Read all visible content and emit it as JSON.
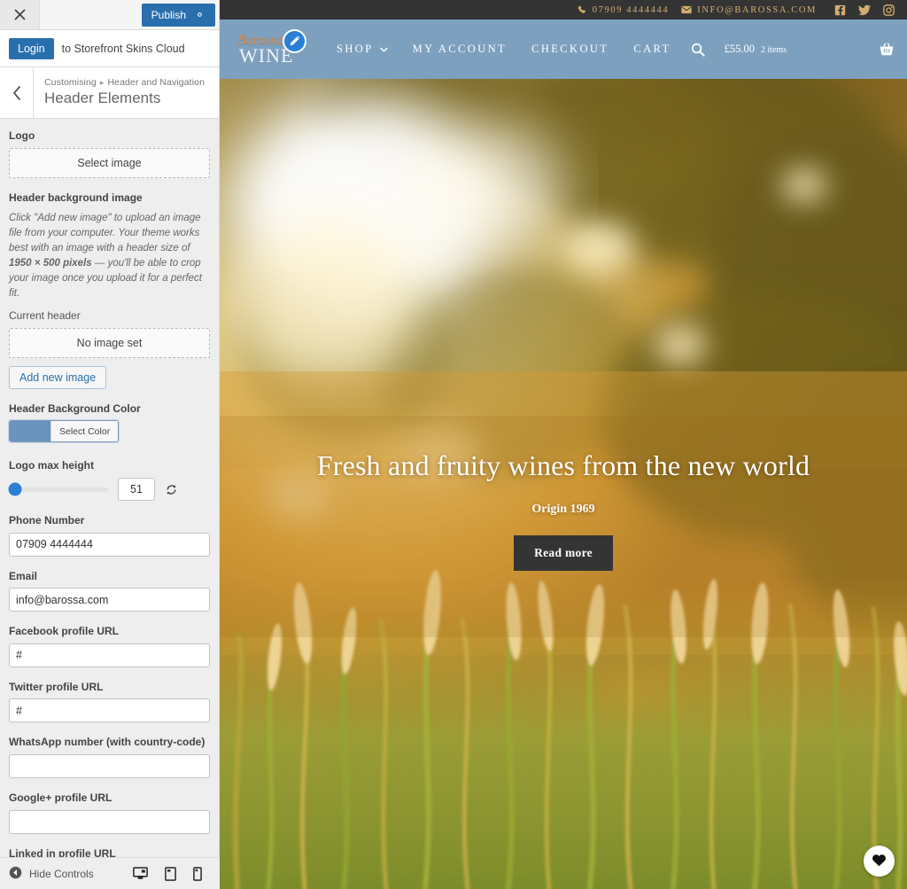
{
  "customizer": {
    "close_label": "Close customizer",
    "publish_label": "Publish",
    "publish_color": "#2a6fad",
    "gear_icon": "gear-icon",
    "cloud_notice": {
      "login_label": "Login",
      "text": "to Storefront Skins Cloud"
    },
    "breadcrumb": {
      "root": "Customising",
      "separator": "▸",
      "parent": "Header and Navigation"
    },
    "panel_title": "Header Elements",
    "controls": {
      "logo": {
        "label": "Logo",
        "button": "Select image"
      },
      "header_background_image": {
        "label": "Header background image",
        "help_before": "Click \"Add new image\" to upload an image file from your computer. Your theme works best with an image with a header size of ",
        "help_dimensions": "1950 × 500 pixels",
        "help_after": " — you'll be able to crop your image once you upload it for a perfect fit.",
        "current_label": "Current header",
        "current_value": "No image set",
        "add_button": "Add new image"
      },
      "header_background_color": {
        "label": "Header Background Color",
        "button": "Select Color",
        "swatch_hex": "#6b93bd"
      },
      "logo_max_height": {
        "label": "Logo max height",
        "value": "51",
        "slider_percent": 6,
        "reset_icon": "reset-icon"
      },
      "phone_number": {
        "label": "Phone Number",
        "value": "07909 4444444",
        "placeholder": ""
      },
      "email": {
        "label": "Email",
        "value": "info@barossa.com",
        "placeholder": ""
      },
      "facebook_url": {
        "label": "Facebook profile URL",
        "value": "#",
        "placeholder": ""
      },
      "twitter_url": {
        "label": "Twitter profile URL",
        "value": "#",
        "placeholder": ""
      },
      "whatsapp_number": {
        "label": "WhatsApp number (with country-code)",
        "value": "",
        "placeholder": ""
      },
      "google_plus_url": {
        "label": "Google+ profile URL",
        "value": "",
        "placeholder": ""
      },
      "linkedin_url": {
        "label": "Linked in profile URL",
        "value": "",
        "placeholder": ""
      }
    },
    "footer": {
      "hide_controls": "Hide Controls",
      "devices": [
        {
          "name": "desktop-preview-button",
          "icon": "desktop-icon",
          "active": true
        },
        {
          "name": "tablet-preview-button",
          "icon": "tablet-icon",
          "active": false
        },
        {
          "name": "mobile-preview-button",
          "icon": "mobile-icon",
          "active": false
        }
      ]
    }
  },
  "preview": {
    "topbar": {
      "background_hex": "#343434",
      "text_hex": "#d3ad71",
      "phone": "07909 4444444",
      "email": "INFO@BAROSSA.COM",
      "social": [
        "facebook-icon",
        "twitter-icon",
        "instagram-icon"
      ]
    },
    "nav": {
      "background_hex": "#7da0bf",
      "logo_script": "Barossa",
      "logo_word": "WINE",
      "edit_badge_icon": "pencil-edit-icon",
      "links": [
        {
          "label": "SHOP",
          "has_dropdown": true
        },
        {
          "label": "MY ACCOUNT",
          "has_dropdown": false
        },
        {
          "label": "CHECKOUT",
          "has_dropdown": false
        },
        {
          "label": "CART",
          "has_dropdown": false
        }
      ],
      "search_icon": "search-icon",
      "cart_amount": "£55.00",
      "cart_items": "2 items",
      "cart_icon": "basket-icon"
    },
    "hero": {
      "title": "Fresh and fruity wines from the new world",
      "subtitle": "Origin 1969",
      "button": "Read more",
      "favourite_icon": "heart-icon"
    }
  }
}
